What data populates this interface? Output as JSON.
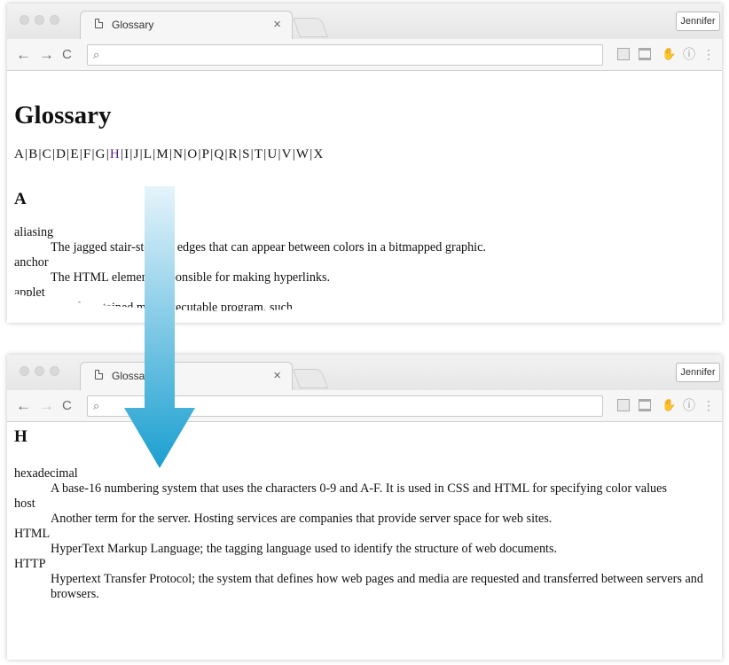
{
  "browser": {
    "tab_title": "Glossary",
    "close_glyph": "×",
    "user_button": "Jennifer",
    "back_glyph": "←",
    "forward_glyph": "→",
    "reload_glyph": "C",
    "search_glyph": "⌕",
    "info_glyph": "ⓘ",
    "menu_glyph": "⋮"
  },
  "top_page": {
    "heading": "Glossary",
    "alphabet": [
      "A",
      "B",
      "C",
      "D",
      "E",
      "F",
      "G",
      "H",
      "I",
      "J",
      "L",
      "M",
      "N",
      "O",
      "P",
      "Q",
      "R",
      "S",
      "T",
      "U",
      "V",
      "W",
      "X"
    ],
    "visited_letter": "H",
    "section_letter": "A",
    "terms": [
      {
        "term": "aliasing",
        "definition": "The jagged stair-stepped edges that can appear between colors in a bitmapped graphic."
      },
      {
        "term": "anchor",
        "definition": "The HTML element responsible for making hyperlinks."
      },
      {
        "term": "applet",
        "definition": "A self-contained mini-executable program, such"
      }
    ]
  },
  "bottom_page": {
    "section_letter": "H",
    "terms": [
      {
        "term": "hexadecimal",
        "definition": "A base-16 numbering system that uses the characters 0-9 and A-F. It is used in CSS and HTML for specifying color values"
      },
      {
        "term": "host",
        "definition": "Another term for the server. Hosting services are companies that provide server space for web sites."
      },
      {
        "term": "HTML",
        "definition": "HyperText Markup Language; the tagging language used to identify the structure of web documents."
      },
      {
        "term": "HTTP",
        "definition": "Hypertext Transfer Protocol; the system that defines how web pages and media are requested and transferred between servers and browsers."
      }
    ]
  },
  "colors": {
    "arrow_top": "#e6f4fb",
    "arrow_bottom": "#1a9fd0",
    "visited_link": "#551a8b"
  }
}
